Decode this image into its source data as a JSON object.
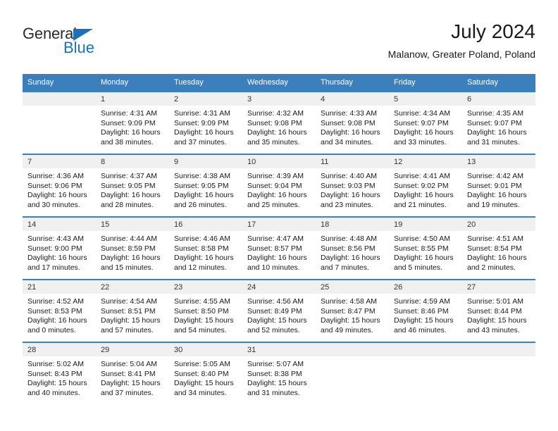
{
  "brand": {
    "name_top": "General",
    "name_bottom": "Blue",
    "triangle_color": "#1a71b8"
  },
  "header": {
    "title": "July 2024",
    "subtitle": "Malanow, Greater Poland, Poland"
  },
  "theme": {
    "header_bg": "#3c7fbd",
    "header_text": "#ffffff",
    "daynum_bg": "#f0f0f0",
    "text": "#1a1a1a"
  },
  "calendar": {
    "weekdays": [
      "Sunday",
      "Monday",
      "Tuesday",
      "Wednesday",
      "Thursday",
      "Friday",
      "Saturday"
    ],
    "weeks": [
      [
        {
          "day": "",
          "lines": []
        },
        {
          "day": "1",
          "lines": [
            "Sunrise: 4:31 AM",
            "Sunset: 9:09 PM",
            "Daylight: 16 hours",
            "and 38 minutes."
          ]
        },
        {
          "day": "2",
          "lines": [
            "Sunrise: 4:31 AM",
            "Sunset: 9:09 PM",
            "Daylight: 16 hours",
            "and 37 minutes."
          ]
        },
        {
          "day": "3",
          "lines": [
            "Sunrise: 4:32 AM",
            "Sunset: 9:08 PM",
            "Daylight: 16 hours",
            "and 35 minutes."
          ]
        },
        {
          "day": "4",
          "lines": [
            "Sunrise: 4:33 AM",
            "Sunset: 9:08 PM",
            "Daylight: 16 hours",
            "and 34 minutes."
          ]
        },
        {
          "day": "5",
          "lines": [
            "Sunrise: 4:34 AM",
            "Sunset: 9:07 PM",
            "Daylight: 16 hours",
            "and 33 minutes."
          ]
        },
        {
          "day": "6",
          "lines": [
            "Sunrise: 4:35 AM",
            "Sunset: 9:07 PM",
            "Daylight: 16 hours",
            "and 31 minutes."
          ]
        }
      ],
      [
        {
          "day": "7",
          "lines": [
            "Sunrise: 4:36 AM",
            "Sunset: 9:06 PM",
            "Daylight: 16 hours",
            "and 30 minutes."
          ]
        },
        {
          "day": "8",
          "lines": [
            "Sunrise: 4:37 AM",
            "Sunset: 9:05 PM",
            "Daylight: 16 hours",
            "and 28 minutes."
          ]
        },
        {
          "day": "9",
          "lines": [
            "Sunrise: 4:38 AM",
            "Sunset: 9:05 PM",
            "Daylight: 16 hours",
            "and 26 minutes."
          ]
        },
        {
          "day": "10",
          "lines": [
            "Sunrise: 4:39 AM",
            "Sunset: 9:04 PM",
            "Daylight: 16 hours",
            "and 25 minutes."
          ]
        },
        {
          "day": "11",
          "lines": [
            "Sunrise: 4:40 AM",
            "Sunset: 9:03 PM",
            "Daylight: 16 hours",
            "and 23 minutes."
          ]
        },
        {
          "day": "12",
          "lines": [
            "Sunrise: 4:41 AM",
            "Sunset: 9:02 PM",
            "Daylight: 16 hours",
            "and 21 minutes."
          ]
        },
        {
          "day": "13",
          "lines": [
            "Sunrise: 4:42 AM",
            "Sunset: 9:01 PM",
            "Daylight: 16 hours",
            "and 19 minutes."
          ]
        }
      ],
      [
        {
          "day": "14",
          "lines": [
            "Sunrise: 4:43 AM",
            "Sunset: 9:00 PM",
            "Daylight: 16 hours",
            "and 17 minutes."
          ]
        },
        {
          "day": "15",
          "lines": [
            "Sunrise: 4:44 AM",
            "Sunset: 8:59 PM",
            "Daylight: 16 hours",
            "and 15 minutes."
          ]
        },
        {
          "day": "16",
          "lines": [
            "Sunrise: 4:46 AM",
            "Sunset: 8:58 PM",
            "Daylight: 16 hours",
            "and 12 minutes."
          ]
        },
        {
          "day": "17",
          "lines": [
            "Sunrise: 4:47 AM",
            "Sunset: 8:57 PM",
            "Daylight: 16 hours",
            "and 10 minutes."
          ]
        },
        {
          "day": "18",
          "lines": [
            "Sunrise: 4:48 AM",
            "Sunset: 8:56 PM",
            "Daylight: 16 hours",
            "and 7 minutes."
          ]
        },
        {
          "day": "19",
          "lines": [
            "Sunrise: 4:50 AM",
            "Sunset: 8:55 PM",
            "Daylight: 16 hours",
            "and 5 minutes."
          ]
        },
        {
          "day": "20",
          "lines": [
            "Sunrise: 4:51 AM",
            "Sunset: 8:54 PM",
            "Daylight: 16 hours",
            "and 2 minutes."
          ]
        }
      ],
      [
        {
          "day": "21",
          "lines": [
            "Sunrise: 4:52 AM",
            "Sunset: 8:53 PM",
            "Daylight: 16 hours",
            "and 0 minutes."
          ]
        },
        {
          "day": "22",
          "lines": [
            "Sunrise: 4:54 AM",
            "Sunset: 8:51 PM",
            "Daylight: 15 hours",
            "and 57 minutes."
          ]
        },
        {
          "day": "23",
          "lines": [
            "Sunrise: 4:55 AM",
            "Sunset: 8:50 PM",
            "Daylight: 15 hours",
            "and 54 minutes."
          ]
        },
        {
          "day": "24",
          "lines": [
            "Sunrise: 4:56 AM",
            "Sunset: 8:49 PM",
            "Daylight: 15 hours",
            "and 52 minutes."
          ]
        },
        {
          "day": "25",
          "lines": [
            "Sunrise: 4:58 AM",
            "Sunset: 8:47 PM",
            "Daylight: 15 hours",
            "and 49 minutes."
          ]
        },
        {
          "day": "26",
          "lines": [
            "Sunrise: 4:59 AM",
            "Sunset: 8:46 PM",
            "Daylight: 15 hours",
            "and 46 minutes."
          ]
        },
        {
          "day": "27",
          "lines": [
            "Sunrise: 5:01 AM",
            "Sunset: 8:44 PM",
            "Daylight: 15 hours",
            "and 43 minutes."
          ]
        }
      ],
      [
        {
          "day": "28",
          "lines": [
            "Sunrise: 5:02 AM",
            "Sunset: 8:43 PM",
            "Daylight: 15 hours",
            "and 40 minutes."
          ]
        },
        {
          "day": "29",
          "lines": [
            "Sunrise: 5:04 AM",
            "Sunset: 8:41 PM",
            "Daylight: 15 hours",
            "and 37 minutes."
          ]
        },
        {
          "day": "30",
          "lines": [
            "Sunrise: 5:05 AM",
            "Sunset: 8:40 PM",
            "Daylight: 15 hours",
            "and 34 minutes."
          ]
        },
        {
          "day": "31",
          "lines": [
            "Sunrise: 5:07 AM",
            "Sunset: 8:38 PM",
            "Daylight: 15 hours",
            "and 31 minutes."
          ]
        },
        {
          "day": "",
          "lines": []
        },
        {
          "day": "",
          "lines": []
        },
        {
          "day": "",
          "lines": []
        }
      ]
    ]
  }
}
